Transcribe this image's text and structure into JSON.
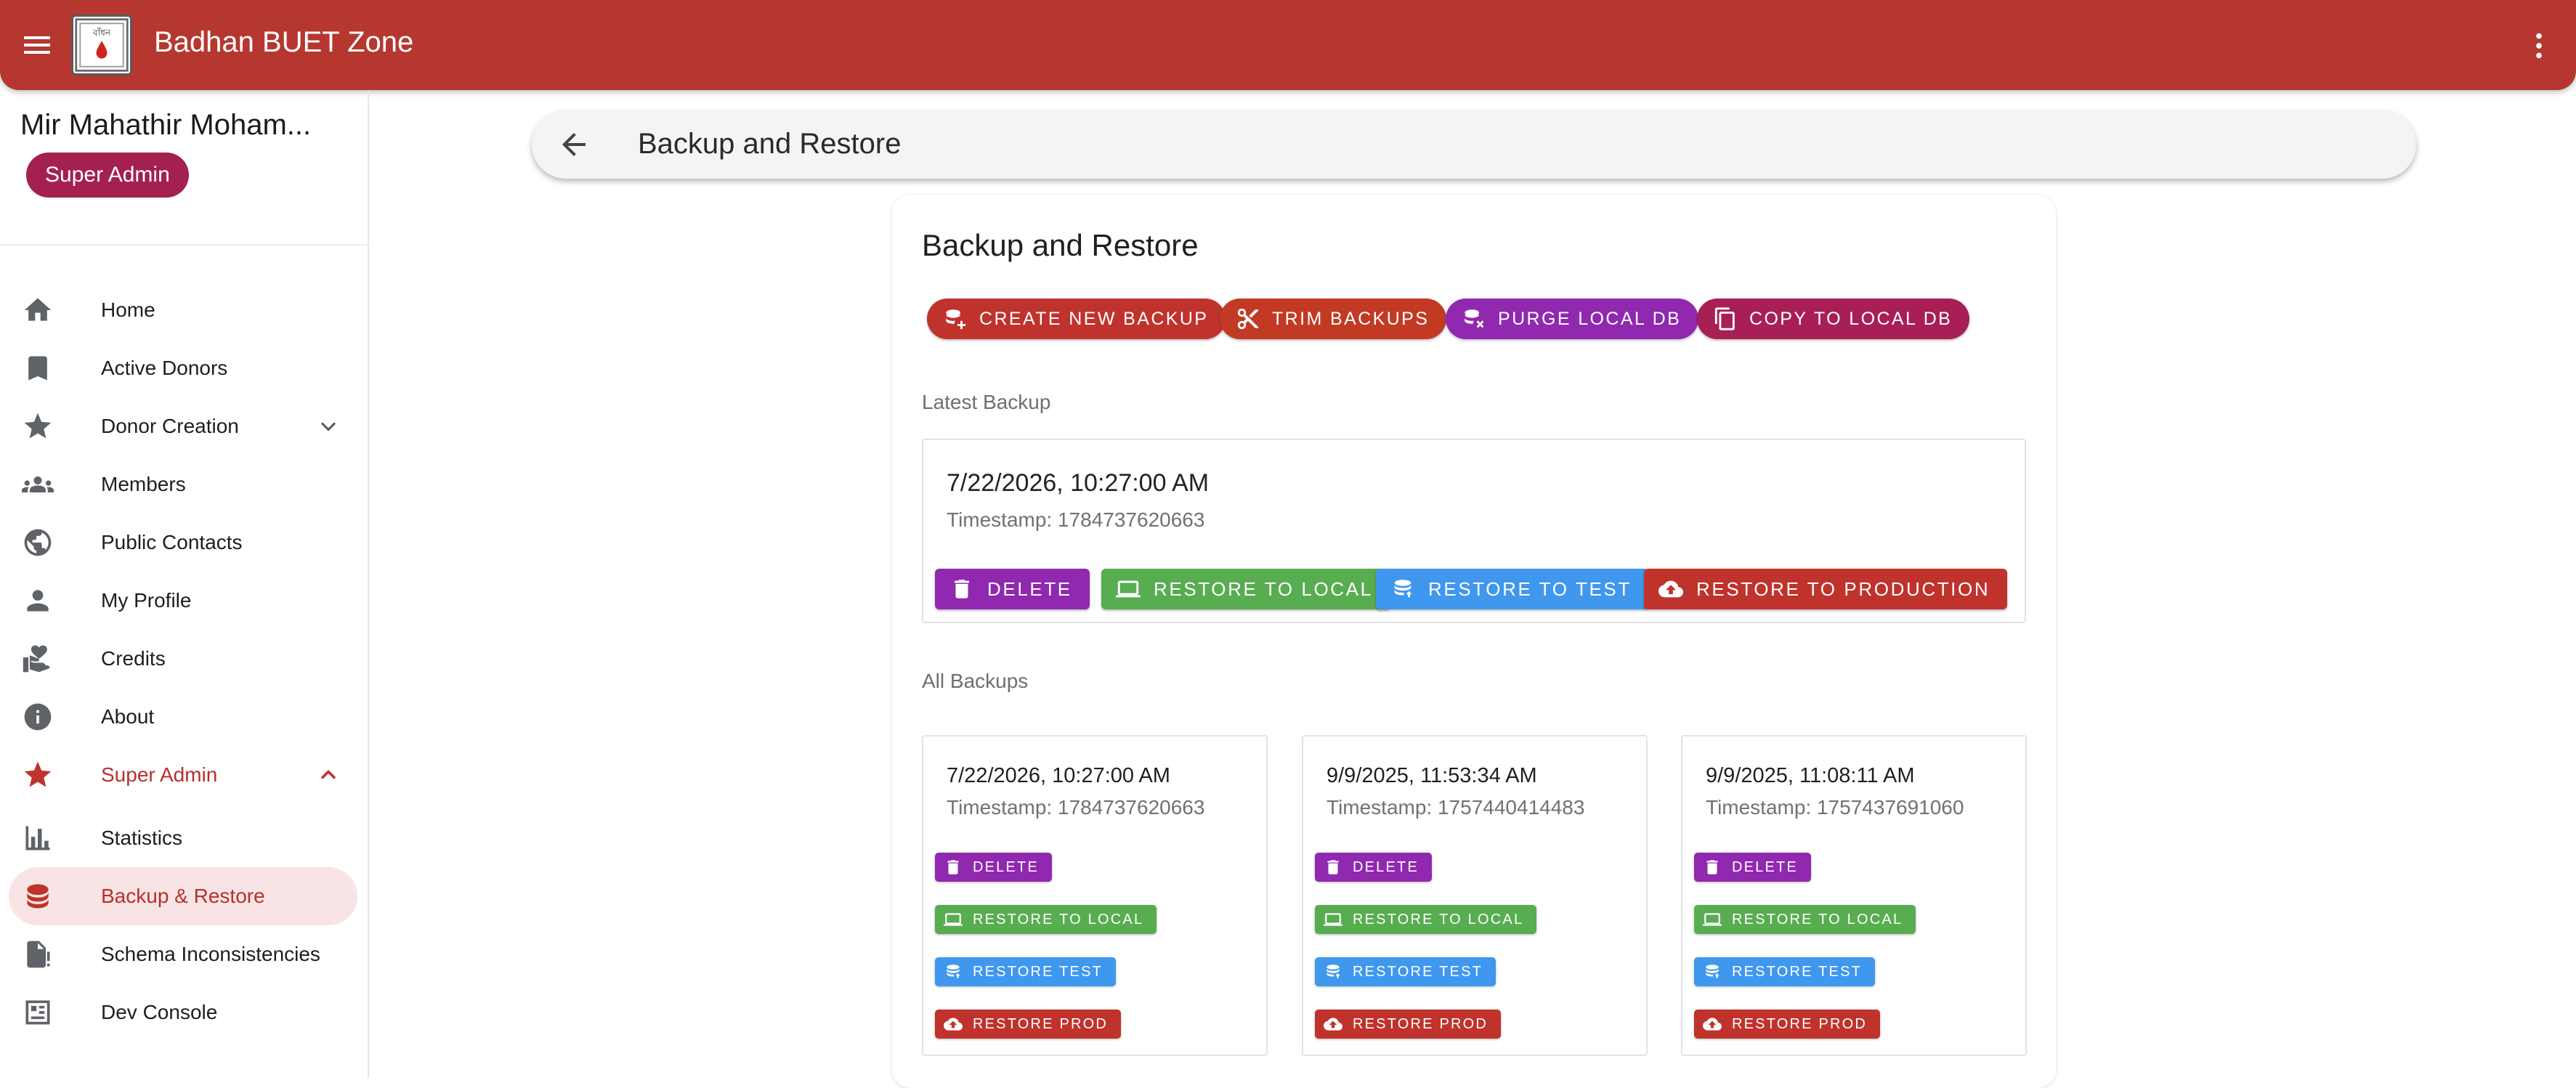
{
  "app": {
    "title": "Badhan BUET Zone",
    "logo_text": "বাঁধন"
  },
  "sidebar": {
    "user_name": "Mir Mahathir Moham...",
    "role": "Super Admin",
    "items": [
      {
        "label": "Home",
        "icon": "home-icon"
      },
      {
        "label": "Active Donors",
        "icon": "bookmark-icon"
      },
      {
        "label": "Donor Creation",
        "icon": "star-icon",
        "expand": "chevron-down"
      },
      {
        "label": "Members",
        "icon": "people-icon"
      },
      {
        "label": "Public Contacts",
        "icon": "globe-icon"
      },
      {
        "label": "My Profile",
        "icon": "person-icon"
      },
      {
        "label": "Credits",
        "icon": "hand-heart-icon"
      },
      {
        "label": "About",
        "icon": "info-icon"
      },
      {
        "label": "Super Admin",
        "icon": "star-icon",
        "expand": "chevron-up"
      },
      {
        "label": "Statistics",
        "icon": "bar-chart-icon"
      },
      {
        "label": "Backup & Restore",
        "icon": "database-icon",
        "active": true
      },
      {
        "label": "Schema Inconsistencies",
        "icon": "file-alert-icon"
      },
      {
        "label": "Dev Console",
        "icon": "console-icon"
      }
    ]
  },
  "topbar": {
    "title": "Backup and Restore"
  },
  "main": {
    "title": "Backup and Restore",
    "actions": {
      "create": "CREATE NEW BACKUP",
      "trim": "TRIM BACKUPS",
      "purge": "PURGE LOCAL DB",
      "copy": "COPY TO LOCAL DB"
    },
    "latest_label": "Latest Backup",
    "latest": {
      "date": "7/22/2026, 10:27:00 AM",
      "timestamp": "Timestamp: 1784737620663",
      "buttons": {
        "delete": "DELETE",
        "restore_local": "RESTORE TO LOCAL",
        "restore_test": "RESTORE TO TEST",
        "restore_prod": "RESTORE TO PRODUCTION"
      }
    },
    "all_label": "All Backups",
    "backups": [
      {
        "date": "7/22/2026, 10:27:00 AM",
        "timestamp": "Timestamp: 1784737620663"
      },
      {
        "date": "9/9/2025, 11:53:34 AM",
        "timestamp": "Timestamp: 1757440414483"
      },
      {
        "date": "9/9/2025, 11:08:11 AM",
        "timestamp": "Timestamp: 1757437691060"
      }
    ],
    "backup_buttons": {
      "delete": "DELETE",
      "restore_local": "RESTORE TO LOCAL",
      "restore_test": "RESTORE TEST",
      "restore_prod": "RESTORE PROD"
    }
  },
  "colors": {
    "appbar": "#b53730",
    "purple": "#9028b0",
    "green": "#58ad50",
    "blue": "#3f97ee",
    "red": "#c0322c",
    "magenta": "#a71f54"
  }
}
